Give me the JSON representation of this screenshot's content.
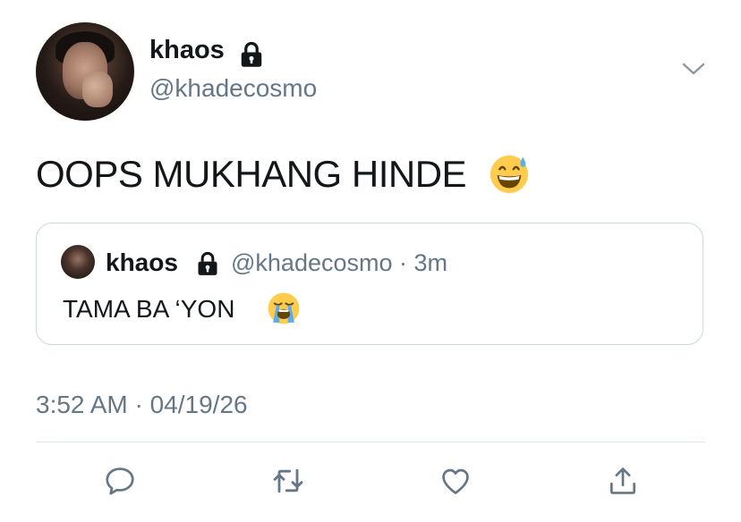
{
  "tweet": {
    "display_name": "khaos",
    "handle": "@khadecosmo",
    "protected": true,
    "text": "OOPS MUKHANG HINDE",
    "emoji": "grinning-face-with-sweat",
    "timestamp": "3:52 AM · 04/19/26"
  },
  "quoted_tweet": {
    "display_name": "khaos",
    "handle_and_time": "@khadecosmo · 3m",
    "text": "TAMA BA ‘YON",
    "emoji": "loudly-crying-face"
  },
  "actions": [
    {
      "name": "reply",
      "icon": "comment-icon"
    },
    {
      "name": "retweet",
      "icon": "retweet-icon"
    },
    {
      "name": "like",
      "icon": "heart-icon"
    },
    {
      "name": "share",
      "icon": "share-icon"
    }
  ],
  "colors": {
    "text": "#14171a",
    "secondary": "#657786",
    "border": "#ccd6dd",
    "divider": "#e1e8ed"
  }
}
